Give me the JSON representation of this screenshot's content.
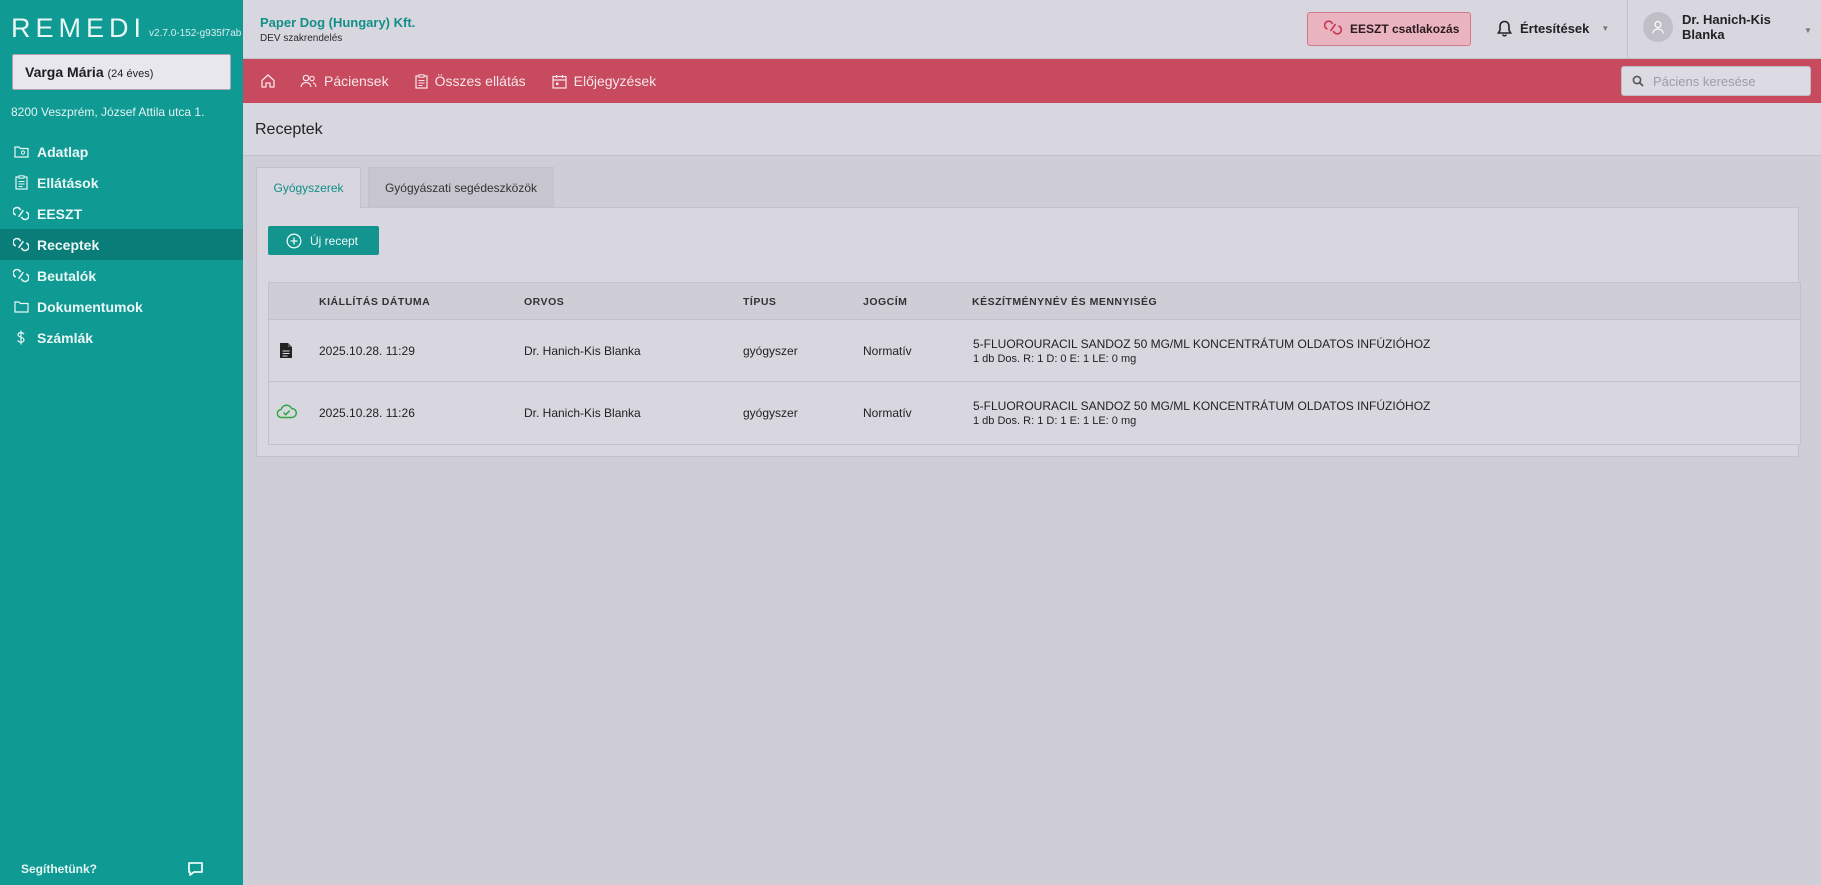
{
  "app": {
    "logo": "REMEDI",
    "version": "v2.7.0-152-g935f7ab"
  },
  "patient": {
    "name": "Varga Mária",
    "age": "(24 éves)",
    "address": "8200 Veszprém, József Attila utca 1."
  },
  "sidebar": {
    "items": [
      {
        "label": "Adatlap",
        "icon": "folder-icon"
      },
      {
        "label": "Ellátások",
        "icon": "clipboard-icon"
      },
      {
        "label": "EESZT",
        "icon": "eeszt-icon"
      },
      {
        "label": "Receptek",
        "icon": "pills-icon",
        "active": true
      },
      {
        "label": "Beutalók",
        "icon": "pills-icon"
      },
      {
        "label": "Dokumentumok",
        "icon": "folder-icon"
      },
      {
        "label": "Számlák",
        "icon": "dollar-icon"
      }
    ],
    "help": "Segíthetünk?"
  },
  "header": {
    "org_name": "Paper Dog (Hungary) Kft.",
    "org_sub": "DEV szakrendelés",
    "eeszt_button": "EESZT csatlakozás",
    "notifications": "Értesítések",
    "user_name": "Dr. Hanich-Kis Blanka"
  },
  "navbar": {
    "links": [
      "Páciensek",
      "Összes ellátás",
      "Előjegyzések"
    ],
    "search_placeholder": "Páciens keresése"
  },
  "page": {
    "title": "Receptek",
    "tabs": [
      "Gyógyszerek",
      "Gyógyászati segédeszközök"
    ],
    "new_button": "Új recept"
  },
  "table": {
    "headers": [
      "KIÁLLÍTÁS DÁTUMA",
      "ORVOS",
      "TÍPUS",
      "JOGCÍM",
      "KÉSZÍTMÉNYNÉV ÉS MENNYISÉG"
    ],
    "rows": [
      {
        "status_icon": "document-icon",
        "date": "2025.10.28. 11:29",
        "doctor": "Dr. Hanich-Kis Blanka",
        "type": "gyógyszer",
        "legal": "Normatív",
        "product": "5-FLUOROURACIL SANDOZ 50 MG/ML KONCENTRÁTUM OLDATOS INFÚZIÓHOZ",
        "quantity": "1 db Dos. R: 1 D: 0 E: 1 LE: 0 mg"
      },
      {
        "status_icon": "cloud-check-icon",
        "date": "2025.10.28. 11:26",
        "doctor": "Dr. Hanich-Kis Blanka",
        "type": "gyógyszer",
        "legal": "Normatív",
        "product": "5-FLUOROURACIL SANDOZ 50 MG/ML KONCENTRÁTUM OLDATOS INFÚZIÓHOZ",
        "quantity": "1 db Dos. R: 1 D: 1 E: 1 LE: 0 mg"
      }
    ]
  },
  "colors": {
    "sidebar": "#0f9a94",
    "navbar": "#c74a5e",
    "accent": "#13948e"
  }
}
